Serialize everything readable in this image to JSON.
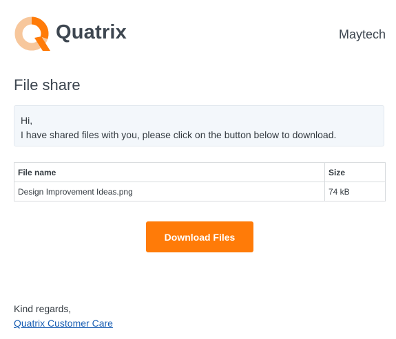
{
  "brand": {
    "logo_name": "Quatrix",
    "logo_icon": "quatrix-q-icon",
    "accent_color": "#ff7b08",
    "company": "Maytech"
  },
  "page": {
    "title": "File share"
  },
  "message": {
    "greeting": "Hi,",
    "body": "I have shared files with you, please click on the button below to download."
  },
  "file_table": {
    "columns": [
      "File name",
      "Size"
    ],
    "rows": [
      {
        "name": "Design Improvement Ideas.png",
        "size": "74 kB"
      }
    ]
  },
  "actions": {
    "download_label": "Download Files"
  },
  "footer": {
    "closing": "Kind regards,",
    "signature_link": "Quatrix Customer Care"
  }
}
